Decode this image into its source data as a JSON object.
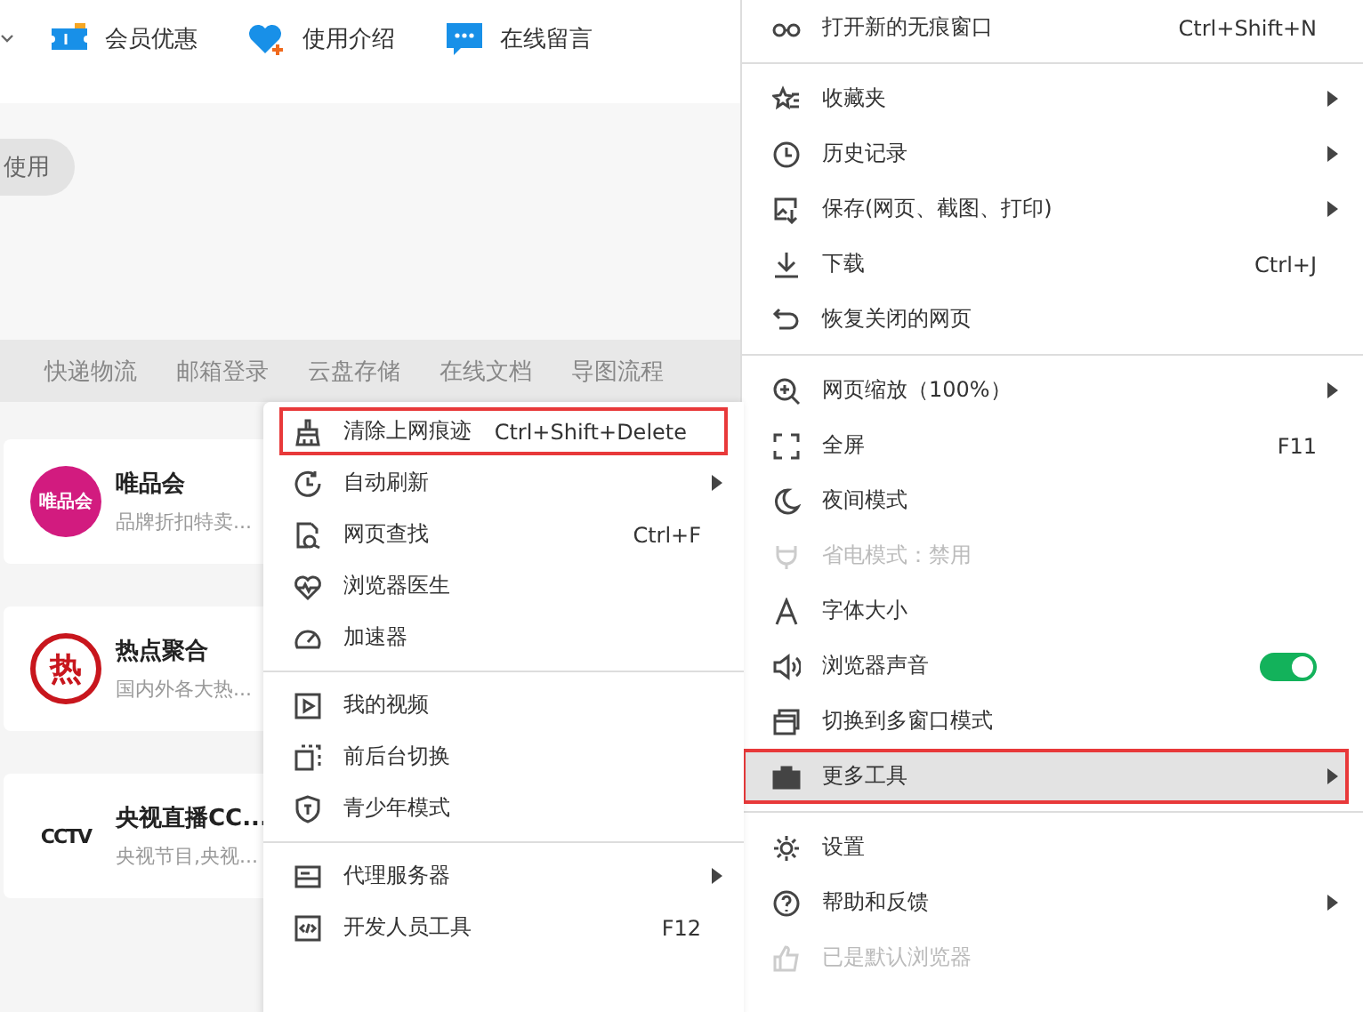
{
  "nav": [
    {
      "label": "会员优惠"
    },
    {
      "label": "使用介绍"
    },
    {
      "label": "在线留言"
    }
  ],
  "pill": "使用",
  "tabs": [
    "快递物流",
    "邮箱登录",
    "云盘存储",
    "在线文档",
    "导图流程"
  ],
  "cards": [
    {
      "title": "唯品会",
      "desc": "品牌折扣特卖...",
      "logo": "唯品会"
    },
    {
      "title": "热点聚合",
      "desc": "国内外各大热...",
      "logo": "热"
    },
    {
      "title": "央视直播CC...",
      "desc": "央视节目,央视...",
      "logo": "CCTV"
    }
  ],
  "menu": {
    "sections": [
      [
        {
          "kind": "item",
          "label": "打开新的无痕窗口",
          "shortcut": "Ctrl+Shift+N",
          "has_submenu": false,
          "disabled": false,
          "selected": false,
          "highlighted": false
        }
      ],
      [
        {
          "kind": "item",
          "label": "收藏夹",
          "has_submenu": true,
          "disabled": false,
          "selected": false,
          "highlighted": false
        },
        {
          "kind": "item",
          "label": "历史记录",
          "has_submenu": true,
          "disabled": false,
          "selected": false,
          "highlighted": false
        },
        {
          "kind": "item",
          "label": "保存(网页、截图、打印)",
          "has_submenu": true,
          "disabled": false,
          "selected": false,
          "highlighted": false
        },
        {
          "kind": "item",
          "label": "下载",
          "shortcut": "Ctrl+J",
          "has_submenu": false,
          "disabled": false,
          "selected": false,
          "highlighted": false
        },
        {
          "kind": "item",
          "label": "恢复关闭的网页",
          "has_submenu": false,
          "disabled": false,
          "selected": false,
          "highlighted": false
        }
      ],
      [
        {
          "kind": "item",
          "label": "网页缩放（100%）",
          "has_submenu": true,
          "disabled": false,
          "selected": false,
          "highlighted": false
        },
        {
          "kind": "item",
          "label": "全屏",
          "shortcut": "F11",
          "has_submenu": false,
          "disabled": false,
          "selected": false,
          "highlighted": false
        },
        {
          "kind": "item",
          "label": "夜间模式",
          "has_submenu": false,
          "disabled": false,
          "selected": false,
          "highlighted": false
        },
        {
          "kind": "item",
          "label": "省电模式：禁用",
          "has_submenu": false,
          "disabled": true,
          "selected": false,
          "highlighted": false
        },
        {
          "kind": "item",
          "label": "字体大小",
          "has_submenu": false,
          "disabled": false,
          "selected": false,
          "highlighted": false
        },
        {
          "kind": "toggle",
          "label": "浏览器声音",
          "on": true,
          "has_submenu": false,
          "disabled": false,
          "selected": false,
          "highlighted": false
        },
        {
          "kind": "item",
          "label": "切换到多窗口模式",
          "has_submenu": false,
          "disabled": false,
          "selected": false,
          "highlighted": false
        },
        {
          "kind": "item",
          "label": "更多工具",
          "has_submenu": true,
          "disabled": false,
          "selected": true,
          "highlighted": true
        }
      ],
      [
        {
          "kind": "item",
          "label": "设置",
          "has_submenu": false,
          "disabled": false,
          "selected": false,
          "highlighted": false
        },
        {
          "kind": "item",
          "label": "帮助和反馈",
          "has_submenu": true,
          "disabled": false,
          "selected": false,
          "highlighted": false
        },
        {
          "kind": "item",
          "label": "已是默认浏览器",
          "has_submenu": false,
          "disabled": true,
          "selected": false,
          "highlighted": false
        }
      ]
    ]
  },
  "submenu": {
    "sections": [
      [
        {
          "label": "清除上网痕迹",
          "shortcut": "Ctrl+Shift+Delete",
          "has_submenu": false,
          "highlighted": true
        },
        {
          "label": "自动刷新",
          "has_submenu": true,
          "highlighted": false
        },
        {
          "label": "网页查找",
          "shortcut": "Ctrl+F",
          "has_submenu": false,
          "highlighted": false
        },
        {
          "label": "浏览器医生",
          "has_submenu": false,
          "highlighted": false
        },
        {
          "label": "加速器",
          "has_submenu": false,
          "highlighted": false
        }
      ],
      [
        {
          "label": "我的视频",
          "has_submenu": false,
          "highlighted": false
        },
        {
          "label": "前后台切换",
          "has_submenu": false,
          "highlighted": false
        },
        {
          "label": "青少年模式",
          "has_submenu": false,
          "highlighted": false
        }
      ],
      [
        {
          "label": "代理服务器",
          "has_submenu": true,
          "highlighted": false
        },
        {
          "label": "开发人员工具",
          "shortcut": "F12",
          "has_submenu": false,
          "highlighted": false
        }
      ]
    ]
  }
}
